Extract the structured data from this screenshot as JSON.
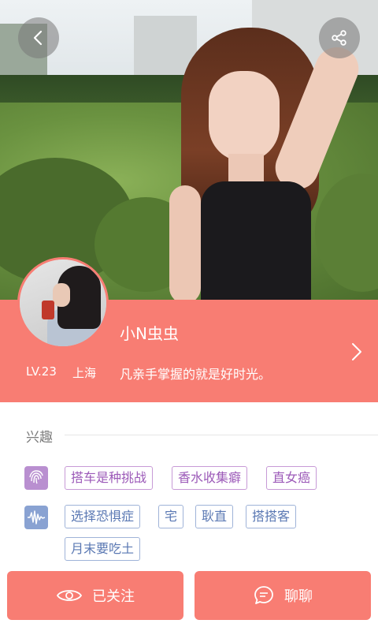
{
  "profile": {
    "username": "小N虫虫",
    "level": "LV.23",
    "city": "上海",
    "signature": "凡亲手掌握的就是好时光。"
  },
  "interests": {
    "title": "兴趣",
    "group1_icon": "fingerprint-icon",
    "group2_icon": "soundwave-icon",
    "group1_tags": [
      "搭车是种挑战",
      "香水收集癖",
      "直女癌"
    ],
    "group2_tags": [
      "选择恐惧症",
      "宅",
      "耿直",
      "搭搭客",
      "月末要吃土"
    ]
  },
  "actions": {
    "follow_label": "已关注",
    "chat_label": "聊聊"
  },
  "colors": {
    "accent": "#f87d73",
    "tag_purple": "#9c5ab8",
    "tag_blue": "#5a78b3"
  }
}
